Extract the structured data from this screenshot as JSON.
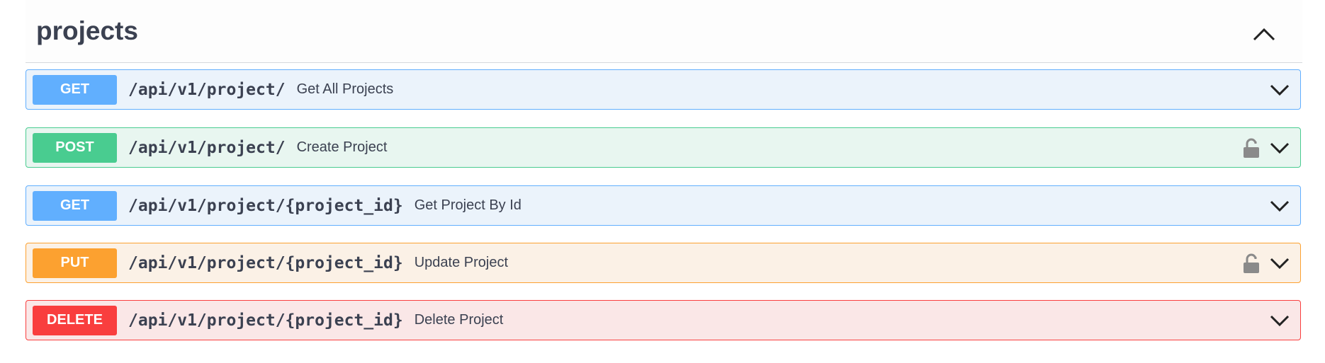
{
  "tag": {
    "title": "projects"
  },
  "operations": [
    {
      "method": "GET",
      "path": "/api/v1/project/",
      "summary": "Get All Projects",
      "locked": false
    },
    {
      "method": "POST",
      "path": "/api/v1/project/",
      "summary": "Create Project",
      "locked": true
    },
    {
      "method": "GET",
      "path": "/api/v1/project/{project_id}",
      "summary": "Get Project By Id",
      "locked": false
    },
    {
      "method": "PUT",
      "path": "/api/v1/project/{project_id}",
      "summary": "Update Project",
      "locked": true
    },
    {
      "method": "DELETE",
      "path": "/api/v1/project/{project_id}",
      "summary": "Delete Project",
      "locked": false
    }
  ],
  "colors": {
    "get": "#61affe",
    "post": "#49cc90",
    "put": "#fca130",
    "delete": "#f93e3e",
    "text": "#3b4151"
  },
  "icons": {
    "collapse": "chevron-up-icon",
    "expand": "chevron-down-icon",
    "lock": "lock-icon"
  }
}
